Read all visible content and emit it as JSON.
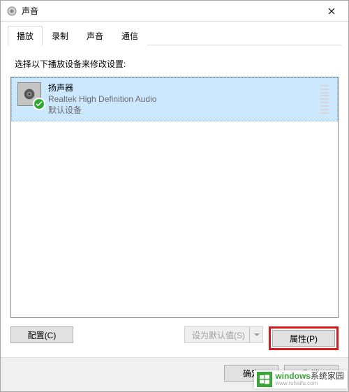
{
  "window": {
    "title": "声音"
  },
  "tabs": {
    "items": [
      "播放",
      "录制",
      "声音",
      "通信"
    ],
    "active_index": 0
  },
  "instruction": "选择以下播放设备来修改设置:",
  "device": {
    "name": "扬声器",
    "description": "Realtek High Definition Audio",
    "status": "默认设备"
  },
  "buttons": {
    "configure": "配置(C)",
    "set_default": "设为默认值(S)",
    "properties": "属性(P)"
  },
  "footer": {
    "ok": "确定",
    "cancel": "取消"
  },
  "watermark": {
    "brand": "windows",
    "suffix": "系统家园",
    "url": "www.ruhaifu.com"
  }
}
